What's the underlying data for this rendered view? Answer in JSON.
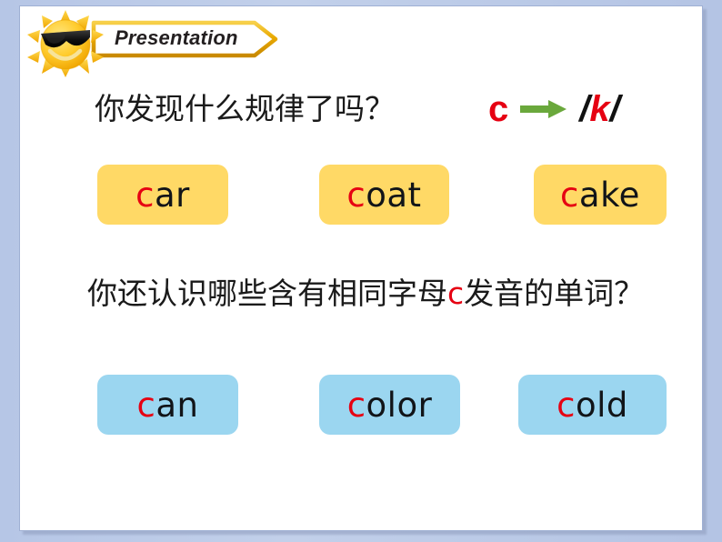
{
  "slide": {
    "banner": {
      "label": "Presentation",
      "icon": "sun-with-sunglasses-icon",
      "border_color": "#e8a900",
      "fill_color": "#ffffff"
    },
    "headline": {
      "question_1": "你发现什么规律了吗？",
      "rule": {
        "letter": "c",
        "letter_color": "#e60012",
        "arrow": "arrow-right-icon",
        "arrow_color": "#6aa83c",
        "phoneme_open": "/",
        "phoneme_symbol": "k",
        "phoneme_close": "/",
        "phoneme_symbol_color": "#e60012",
        "slash_color": "#111111"
      }
    },
    "question_2": {
      "before": "你还认识哪些含有相同字母",
      "highlight": "c",
      "after": "发音的单词？",
      "highlight_color": "#e60012"
    },
    "word_rows": [
      {
        "name": "known-words",
        "fill": "#ffd966",
        "cards": [
          {
            "id": "car",
            "lead": "c",
            "rest": "ar"
          },
          {
            "id": "coat",
            "lead": "c",
            "rest": "oat"
          },
          {
            "id": "cake",
            "lead": "c",
            "rest": "ake"
          }
        ]
      },
      {
        "name": "new-words",
        "fill": "#9bd6f0",
        "cards": [
          {
            "id": "can",
            "lead": "c",
            "rest": "an"
          },
          {
            "id": "color",
            "lead": "c",
            "rest": "olor"
          },
          {
            "id": "cold",
            "lead": "c",
            "rest": "old"
          }
        ]
      }
    ],
    "colors": {
      "page_background": "#b9c8e6",
      "slide_background": "#ffffff",
      "accent_red": "#e60012",
      "accent_green": "#6aa83c",
      "card_yellow": "#ffd966",
      "card_blue": "#9bd6f0"
    }
  }
}
